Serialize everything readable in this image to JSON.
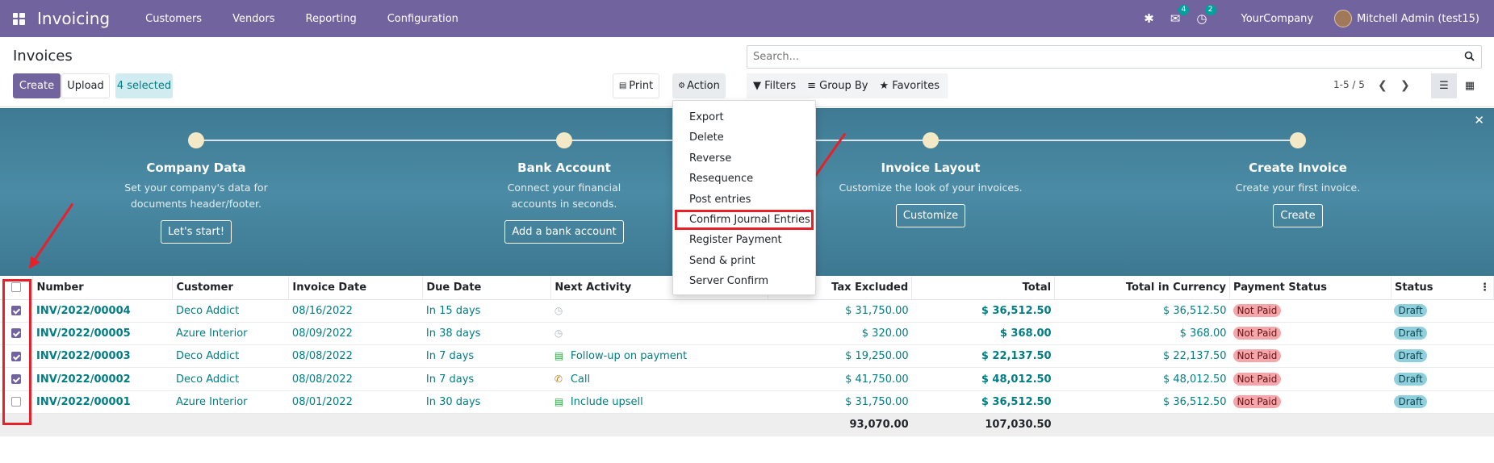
{
  "topbar": {
    "app_name": "Invoicing",
    "menu": [
      "Customers",
      "Vendors",
      "Reporting",
      "Configuration"
    ],
    "messages_count": "4",
    "activities_count": "2",
    "company": "YourCompany",
    "user": "Mitchell Admin (test15)"
  },
  "control_panel": {
    "title": "Invoices",
    "create_label": "Create",
    "upload_label": "Upload",
    "selected_label": "4 selected",
    "print_label": "Print",
    "action_label": "Action",
    "search_placeholder": "Search...",
    "filters_label": "Filters",
    "groupby_label": "Group By",
    "favorites_label": "Favorites",
    "pager": "1-5 / 5"
  },
  "action_menu": [
    "Export",
    "Delete",
    "Reverse",
    "Resequence",
    "Post entries",
    "Confirm Journal Entries",
    "Register Payment",
    "Send & print",
    "Server Confirm"
  ],
  "onboarding": [
    {
      "title": "Company Data",
      "desc": "Set your company's data for documents header/footer.",
      "button": "Let's start!"
    },
    {
      "title": "Bank Account",
      "desc": "Connect your financial accounts in seconds.",
      "button": "Add a bank account"
    },
    {
      "title": "Invoice Layout",
      "desc": "Customize the look of your invoices.",
      "button": "Customize"
    },
    {
      "title": "Create Invoice",
      "desc": "Create your first invoice.",
      "button": "Create"
    }
  ],
  "table": {
    "headers": [
      "Number",
      "Customer",
      "Invoice Date",
      "Due Date",
      "Next Activity",
      "Tax Excluded",
      "Total",
      "Total in Currency",
      "Payment Status",
      "Status"
    ],
    "rows": [
      {
        "checked": true,
        "number": "INV/2022/00004",
        "customer": "Deco Addict",
        "invoice_date": "08/16/2022",
        "due_date": "In 15 days",
        "activity": "",
        "activity_icon": "clock-icon",
        "tax_excluded": "$ 31,750.00",
        "total": "$ 36,512.50",
        "total_currency": "$ 36,512.50",
        "payment_status": "Not Paid",
        "status": "Draft"
      },
      {
        "checked": true,
        "number": "INV/2022/00005",
        "customer": "Azure Interior",
        "invoice_date": "08/09/2022",
        "due_date": "In 38 days",
        "activity": "",
        "activity_icon": "clock-icon",
        "tax_excluded": "$ 320.00",
        "total": "$ 368.00",
        "total_currency": "$ 368.00",
        "payment_status": "Not Paid",
        "status": "Draft"
      },
      {
        "checked": true,
        "number": "INV/2022/00003",
        "customer": "Deco Addict",
        "invoice_date": "08/08/2022",
        "due_date": "In 7 days",
        "activity": "Follow-up on payment",
        "activity_icon": "money-icon",
        "tax_excluded": "$ 19,250.00",
        "total": "$ 22,137.50",
        "total_currency": "$ 22,137.50",
        "payment_status": "Not Paid",
        "status": "Draft"
      },
      {
        "checked": true,
        "number": "INV/2022/00002",
        "customer": "Deco Addict",
        "invoice_date": "08/08/2022",
        "due_date": "In 7 days",
        "activity": "Call",
        "activity_icon": "phone-icon",
        "tax_excluded": "$ 41,750.00",
        "total": "$ 48,012.50",
        "total_currency": "$ 48,012.50",
        "payment_status": "Not Paid",
        "status": "Draft"
      },
      {
        "checked": false,
        "number": "INV/2022/00001",
        "customer": "Azure Interior",
        "invoice_date": "08/01/2022",
        "due_date": "In 30 days",
        "activity": "Include upsell",
        "activity_icon": "money-icon",
        "tax_excluded": "$ 31,750.00",
        "total": "$ 36,512.50",
        "total_currency": "$ 36,512.50",
        "payment_status": "Not Paid",
        "status": "Draft"
      }
    ],
    "totals": {
      "tax_excluded": "93,070.00",
      "total": "107,030.50"
    }
  }
}
